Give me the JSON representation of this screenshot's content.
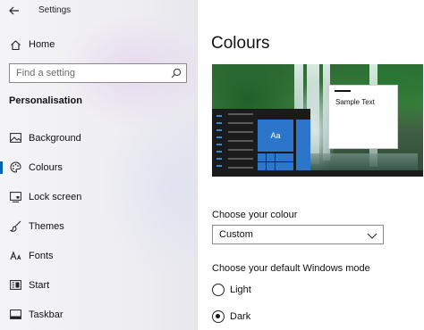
{
  "window": {
    "title": "Settings"
  },
  "sidebar": {
    "home_label": "Home",
    "search": {
      "placeholder": "Find a setting",
      "value": ""
    },
    "section_heading": "Personalisation",
    "items": [
      {
        "label": "Background",
        "icon": "picture-icon",
        "selected": false
      },
      {
        "label": "Colours",
        "icon": "palette-icon",
        "selected": true
      },
      {
        "label": "Lock screen",
        "icon": "lock-screen-icon",
        "selected": false
      },
      {
        "label": "Themes",
        "icon": "brush-icon",
        "selected": false
      },
      {
        "label": "Fonts",
        "icon": "font-icon",
        "selected": false
      },
      {
        "label": "Start",
        "icon": "start-icon",
        "selected": false
      },
      {
        "label": "Taskbar",
        "icon": "taskbar-icon",
        "selected": false
      }
    ]
  },
  "main": {
    "title": "Colours",
    "preview": {
      "tile_text": "Aa",
      "sample_text": "Sample Text"
    },
    "choose_colour": {
      "label": "Choose your colour",
      "selected": "Custom"
    },
    "windows_mode": {
      "label": "Choose your default Windows mode",
      "options": [
        {
          "label": "Light",
          "checked": false
        },
        {
          "label": "Dark",
          "checked": true
        }
      ]
    }
  },
  "colors": {
    "accent": "#0063b1",
    "tile_blue": "#2b76cb",
    "preview_dark": "#1b1b1b"
  }
}
